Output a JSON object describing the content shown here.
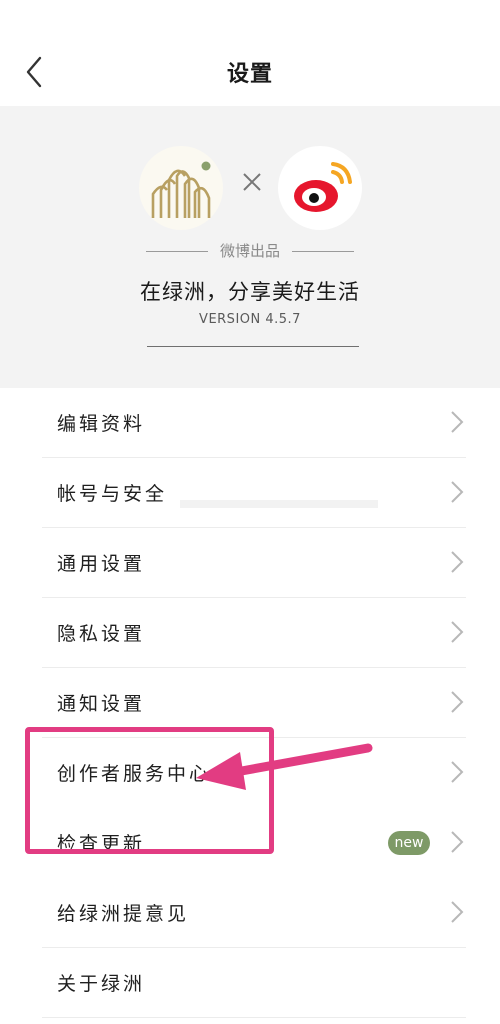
{
  "header": {
    "title": "设置",
    "back_icon": "chevron-left-icon"
  },
  "banner": {
    "times_sign": "×",
    "produced_by": "微博出品",
    "slogan": "在绿洲，分享美好生活",
    "version": "VERSION 4.5.7",
    "colors": {
      "oasis_gold": "#b8a062",
      "oasis_green": "#8aa06c",
      "weibo_red": "#e6162d",
      "weibo_orange": "#f5a623"
    }
  },
  "menu": {
    "items": [
      {
        "label": "编辑资料"
      },
      {
        "label": "帐号与安全"
      },
      {
        "label": "通用设置"
      },
      {
        "label": "隐私设置"
      },
      {
        "label": "通知设置"
      },
      {
        "label": "创作者服务中心"
      },
      {
        "label": "检查更新",
        "badge": "new"
      },
      {
        "label": "给绿洲提意见"
      },
      {
        "label": "关于绿洲"
      }
    ],
    "badge_color": "#7e9a67"
  },
  "annotation": {
    "color": "#e23c82"
  }
}
